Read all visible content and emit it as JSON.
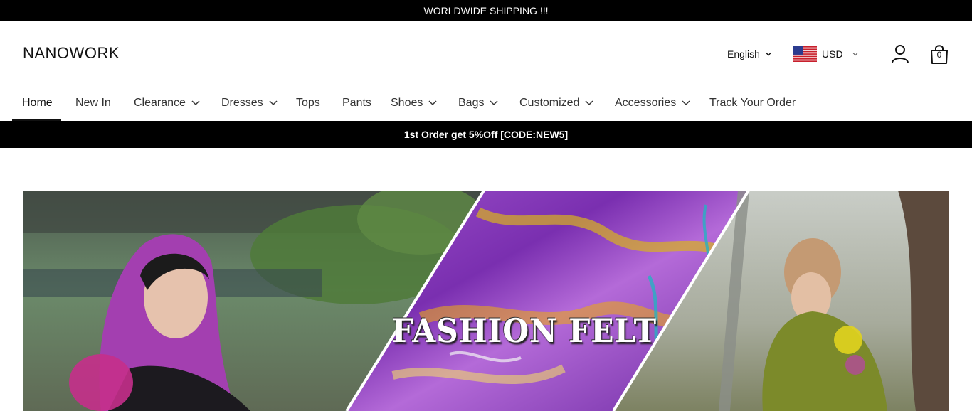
{
  "topbar": {
    "text": "WORLDWIDE SHIPPING !!!"
  },
  "header": {
    "logo": "NANOWORK",
    "language": "English",
    "currency": "USD",
    "cart_count": "0"
  },
  "nav": {
    "items": [
      {
        "label": "Home",
        "dropdown": false,
        "active": true
      },
      {
        "label": "New In",
        "dropdown": false
      },
      {
        "label": "Clearance",
        "dropdown": true
      },
      {
        "label": "Dresses",
        "dropdown": true
      },
      {
        "label": "Tops",
        "dropdown": false
      },
      {
        "label": "Pants",
        "dropdown": false
      },
      {
        "label": "Shoes",
        "dropdown": true
      },
      {
        "label": "Bags",
        "dropdown": true
      },
      {
        "label": "Customized",
        "dropdown": true
      },
      {
        "label": "Accessories",
        "dropdown": true
      },
      {
        "label": "Track Your Order",
        "dropdown": false
      }
    ]
  },
  "promo": {
    "text": "1st Order get 5%Off [CODE:NEW5]"
  },
  "hero": {
    "title": "FASHION FELT"
  },
  "colors": {
    "bar": "#000000",
    "felt_purple": "#8a3fb8",
    "felt_yellow": "#d9b21e",
    "foliage": "#4f7a3a"
  }
}
